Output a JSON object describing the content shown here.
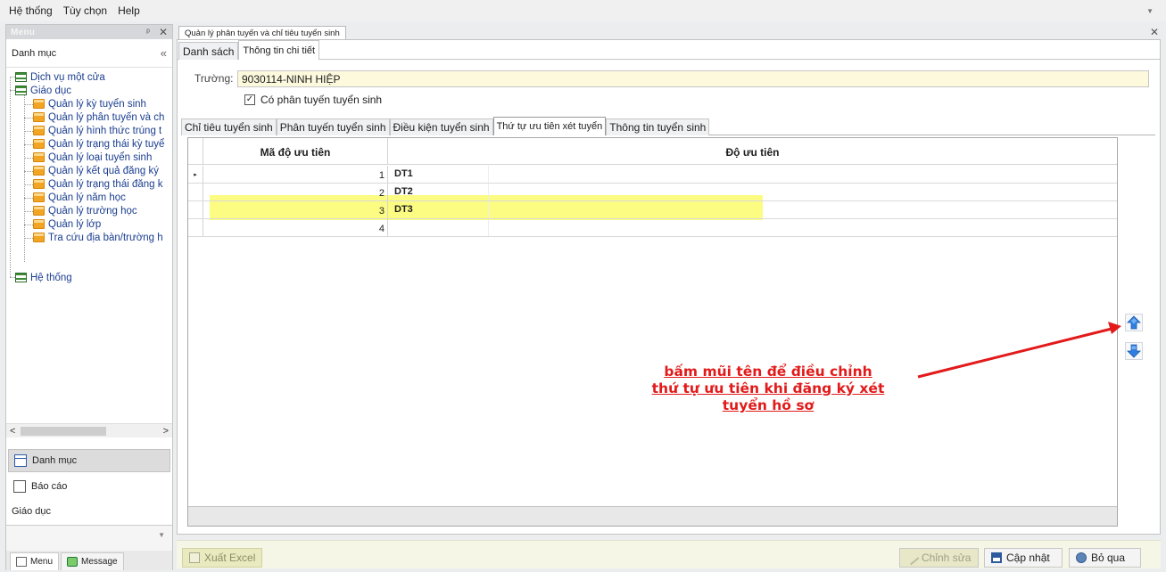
{
  "menubar": {
    "items": [
      "Hệ thống",
      "Tùy chọn",
      "Help"
    ]
  },
  "left_panel": {
    "title": "Menu",
    "category_header": "Danh mục",
    "collapse_glyph": "«",
    "tree": [
      {
        "label": "Dịch vụ một cửa",
        "icon": "grid-icon",
        "level": 0
      },
      {
        "label": "Giáo dục",
        "icon": "grid-icon",
        "level": 0
      },
      {
        "label": "Quản lý kỳ tuyển sinh",
        "icon": "document-icon",
        "level": 1
      },
      {
        "label": "Quản lý phân tuyến và ch",
        "icon": "document-icon",
        "level": 1
      },
      {
        "label": "Quản lý hình thức trúng t",
        "icon": "document-icon",
        "level": 1
      },
      {
        "label": "Quản lý trạng thái kỳ tuyể",
        "icon": "document-icon",
        "level": 1
      },
      {
        "label": "Quản lý loại tuyển sinh",
        "icon": "document-icon",
        "level": 1
      },
      {
        "label": "Quản lý kết quả đăng ký",
        "icon": "document-icon",
        "level": 1
      },
      {
        "label": "Quản lý trạng thái đăng k",
        "icon": "document-icon",
        "level": 1
      },
      {
        "label": "Quản lý năm học",
        "icon": "document-icon",
        "level": 1
      },
      {
        "label": "Quản lý trường học",
        "icon": "document-icon",
        "level": 1
      },
      {
        "label": "Quản lý lớp",
        "icon": "document-icon",
        "level": 1
      },
      {
        "label": "Tra cứu địa bàn/trường h",
        "icon": "document-icon",
        "level": 1
      },
      {
        "label": "Hệ thống",
        "icon": "grid-icon",
        "level": 0
      }
    ],
    "nav_buttons": [
      "Danh mục",
      "Báo cáo"
    ],
    "group_label": "Giáo dục",
    "bottom_tabs": [
      "Menu",
      "Message"
    ]
  },
  "document_tab": {
    "title": "Quản lý phân tuyến và chỉ tiêu tuyển sinh"
  },
  "sub_tabs": [
    "Danh sách",
    "Thông tin chi tiết"
  ],
  "form": {
    "truong_label": "Trường:",
    "truong_value": "9030114-NINH HIỆP",
    "checkbox_label": "Có phân tuyến tuyển sinh",
    "checkbox_checked": true
  },
  "detail_tabs": [
    "Chỉ tiêu tuyển sinh",
    "Phân tuyến tuyển sinh",
    "Điều kiện tuyển sinh",
    "Thứ tự ưu tiên xét tuyển",
    "Thông tin tuyển sinh"
  ],
  "active_detail_tab": "Thứ tự ưu tiên xét tuyển",
  "grid": {
    "columns": [
      "Mã độ ưu tiên",
      "Độ ưu tiên"
    ],
    "rows": [
      {
        "indicator": "▸",
        "ma": "1",
        "do": "DT1"
      },
      {
        "indicator": "",
        "ma": "2",
        "do": "DT2"
      },
      {
        "indicator": "",
        "ma": "3",
        "do": "DT3"
      },
      {
        "indicator": "",
        "ma": "4",
        "do": ""
      }
    ],
    "highlighted_row": 3,
    "highlight_color": "#fbfb58"
  },
  "annotation": {
    "lines": [
      "bấm mũi tên để điều chỉnh",
      "thứ tự ưu tiên khi đăng ký xét",
      "tuyển hồ sơ"
    ],
    "color": "#e21a1a"
  },
  "bottom_bar": {
    "export_label": "Xuất Excel",
    "edit_label": "Chỉnh sửa",
    "update_label": "Cập nhật",
    "cancel_label": "Bỏ qua"
  },
  "colors": {
    "accent_blue": "#2f7fe0",
    "input_bg": "#fdf9dd"
  }
}
